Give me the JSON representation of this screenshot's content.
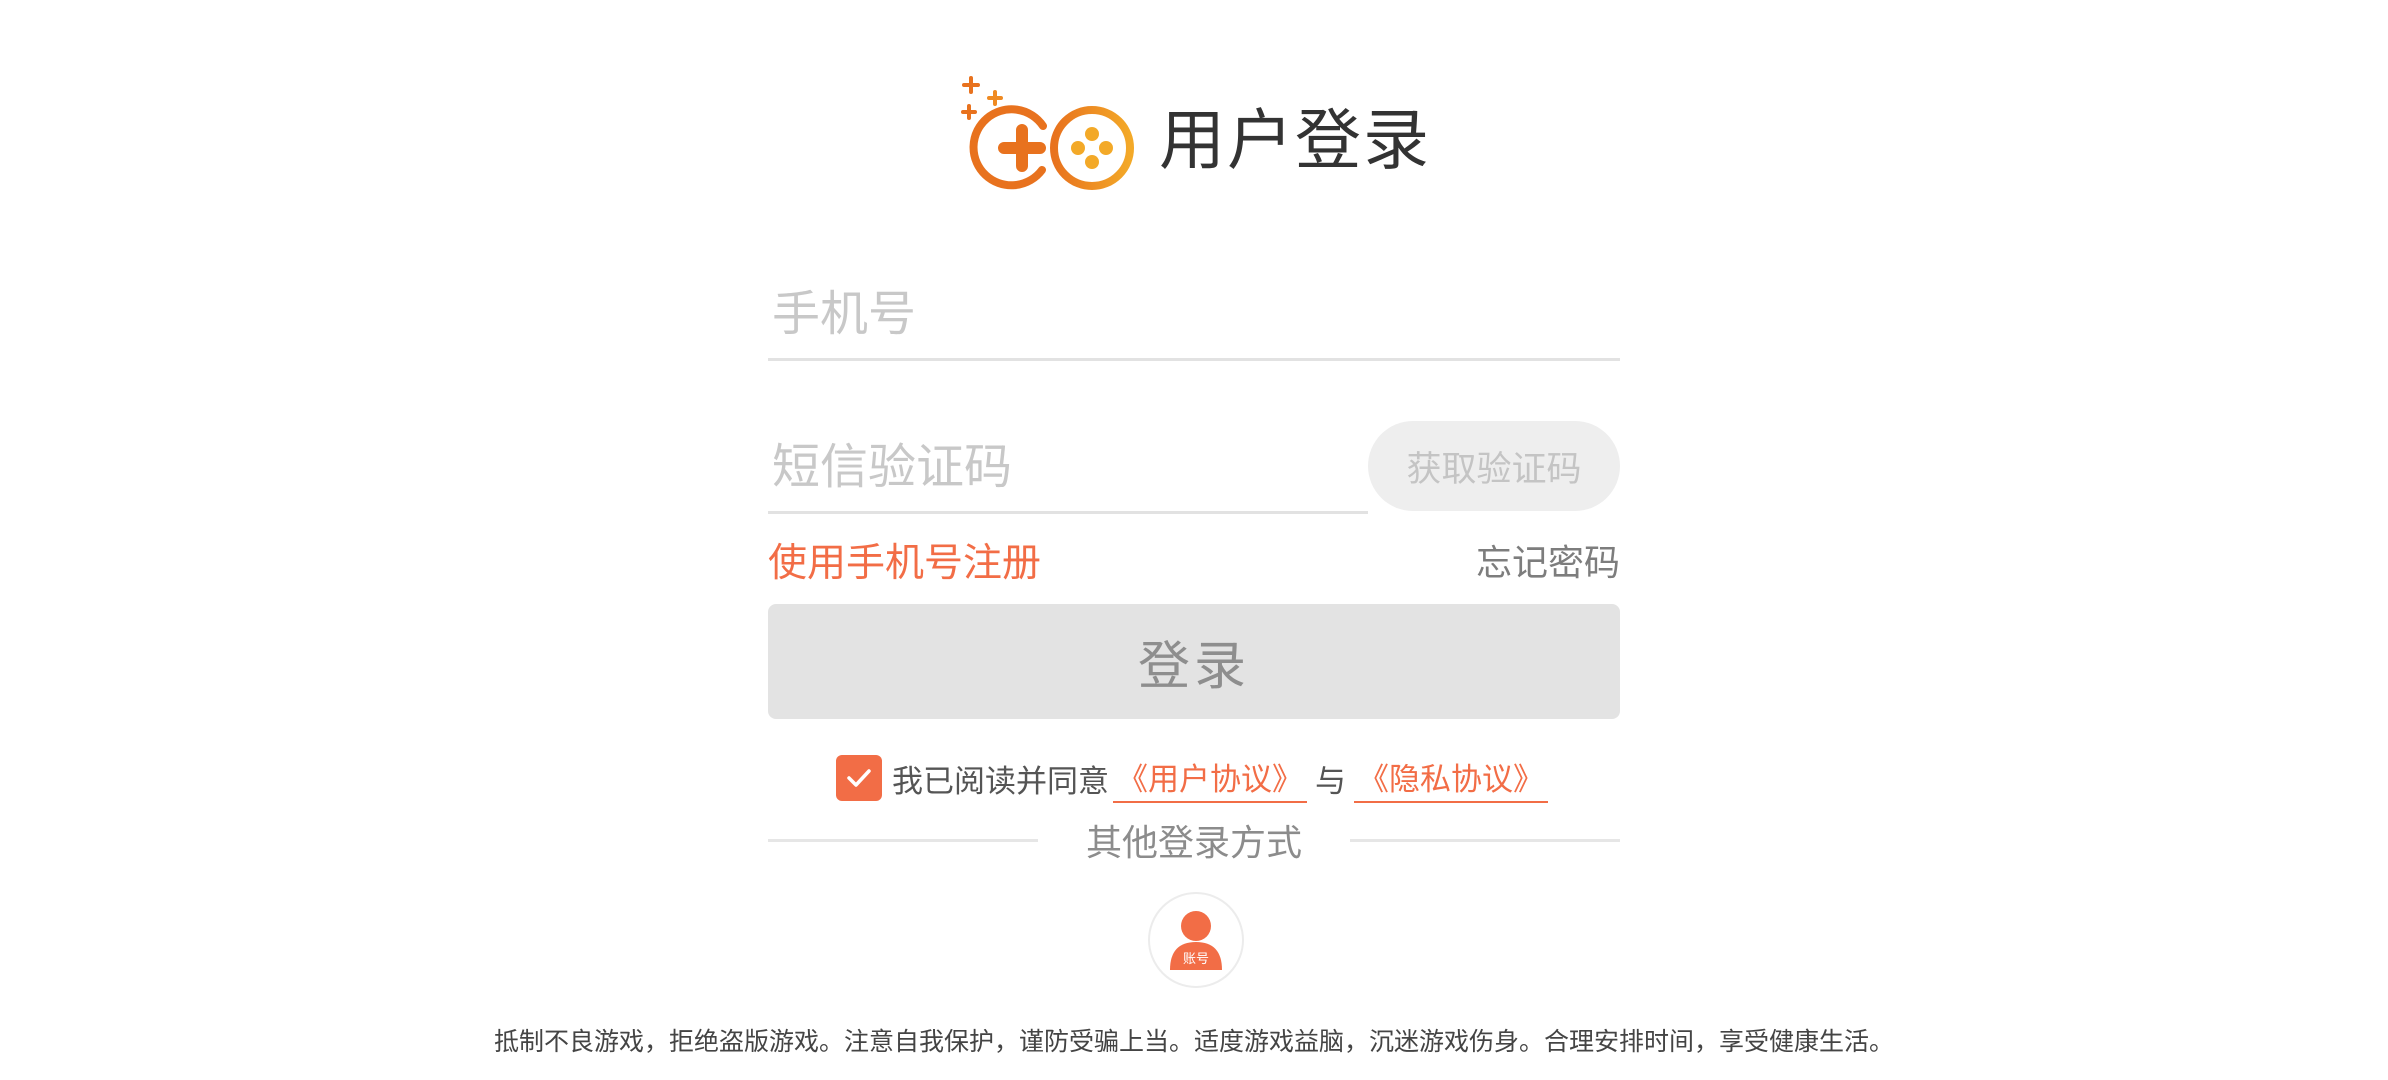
{
  "header": {
    "title": "用户登录",
    "logo_icon": "game-controller-logo-icon"
  },
  "form": {
    "phone_placeholder": "手机号",
    "phone_value": "",
    "code_placeholder": "短信验证码",
    "code_value": "",
    "get_code_label": "获取验证码",
    "register_label": "使用手机号注册",
    "forgot_label": "忘记密码",
    "login_label": "登录"
  },
  "agreement": {
    "checked": true,
    "prefix": "我已阅读并同意",
    "user_agreement": "《用户协议》",
    "conjunction": "与",
    "privacy_agreement": "《隐私协议》"
  },
  "other_login": {
    "label": "其他登录方式",
    "account_label": "账号",
    "account_icon": "user-account-icon"
  },
  "footer": {
    "text": "抵制不良游戏，拒绝盗版游戏。注意自我保护，谨防受骗上当。适度游戏益脑，沉迷游戏伤身。合理安排时间，享受健康生活。"
  },
  "colors": {
    "accent": "#f26d46",
    "logo_orange": "#e8721e",
    "logo_yellow": "#f3a928",
    "button_disabled_bg": "#e3e3e3"
  }
}
